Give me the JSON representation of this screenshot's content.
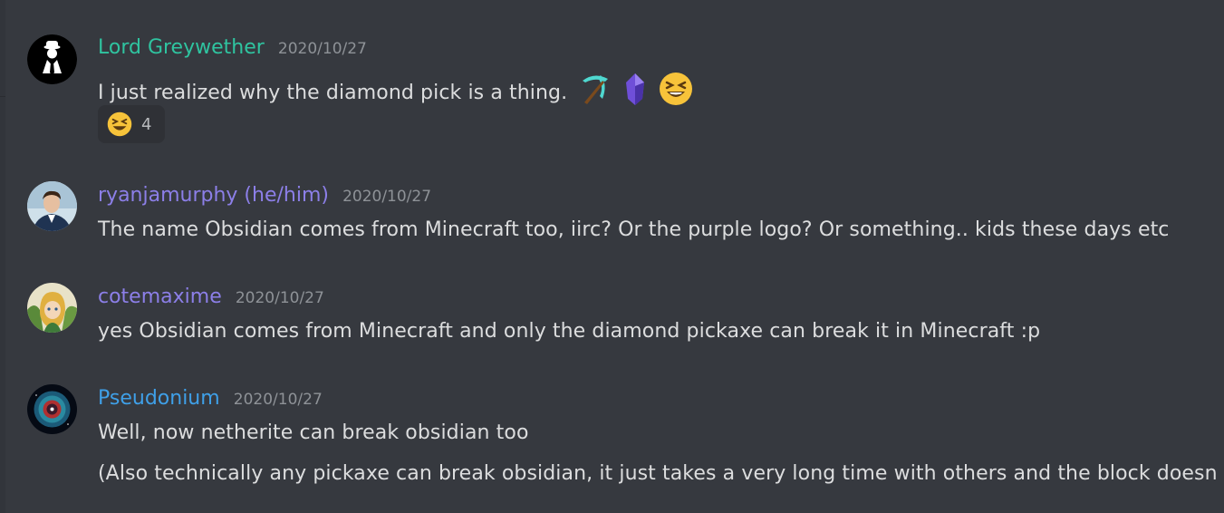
{
  "colors": {
    "background": "#36393f",
    "text": "#dcddde",
    "timestamp": "#8e9297",
    "reaction_bg": "#2f3136"
  },
  "messages": [
    {
      "username": "Lord Greywether",
      "username_color": "#2fc4a0",
      "timestamp": "2020/10/27",
      "lines": [
        "I just realized why the diamond pick is a thing."
      ],
      "inline_icons": [
        "diamond-pickaxe-icon",
        "obsidian-crystal-icon",
        "laughing-emoji-icon"
      ],
      "reactions": [
        {
          "emoji": "laughing-emoji-icon",
          "count": "4"
        }
      ]
    },
    {
      "username": "ryanjamurphy (he/him)",
      "username_color": "#8c7fe8",
      "timestamp": "2020/10/27",
      "lines": [
        "The name Obsidian comes from Minecraft too, iirc? Or the purple logo? Or something.. kids these days etc"
      ]
    },
    {
      "username": "cotemaxime",
      "username_color": "#8c7fe8",
      "timestamp": "2020/10/27",
      "lines": [
        "yes Obsidian comes from Minecraft and only the diamond pickaxe can break it in Minecraft :p"
      ]
    },
    {
      "username": "Pseudonium",
      "username_color": "#3fa0e8",
      "timestamp": "2020/10/27",
      "lines": [
        "Well, now netherite can break obsidian too",
        "(Also technically any pickaxe can break obsidian, it just takes a very long time with others and the block doesn"
      ]
    }
  ]
}
